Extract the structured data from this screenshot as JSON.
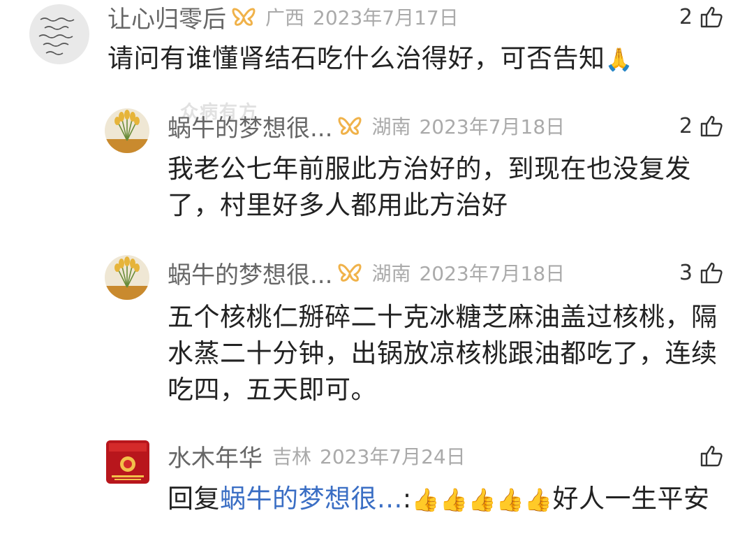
{
  "colors": {
    "username": "#666666",
    "meta": "#aaaaaa",
    "text": "#222222",
    "reply_link": "#3a6ec4",
    "vip_badge": "#f0b24a"
  },
  "watermark": "众病有方",
  "comments": [
    {
      "username": "让心归零后",
      "region": "广西",
      "date": "2023年7月17日",
      "likes": "2",
      "text": "请问有谁懂肾结石吃什么治得好，可否告知",
      "emoji": "🙏",
      "avatar_icon": "handwriting-avatar"
    },
    {
      "username": "蜗牛的梦想很...",
      "region": "湖南",
      "date": "2023年7月18日",
      "likes": "2",
      "text": "我老公七年前服此方治好的，到现在也没复发了，村里好多人都用此方治好",
      "avatar_icon": "plant-avatar"
    },
    {
      "username": "蜗牛的梦想很...",
      "region": "湖南",
      "date": "2023年7月18日",
      "likes": "3",
      "text": "五个核桃仁掰碎二十克冰糖芝麻油盖过核桃，隔水蒸二十分钟，出锅放凉核桃跟油都吃了，连续吃四，五天即可。",
      "avatar_icon": "plant-avatar"
    },
    {
      "username": "水木年华",
      "region": "吉林",
      "date": "2023年7月24日",
      "likes": "",
      "reply_prefix": "回复",
      "reply_to": "蜗牛的梦想很...",
      "reply_sep": ":",
      "emoji": "👍👍👍👍👍",
      "text": "好人一生平安",
      "avatar_icon": "red-card-avatar"
    }
  ]
}
